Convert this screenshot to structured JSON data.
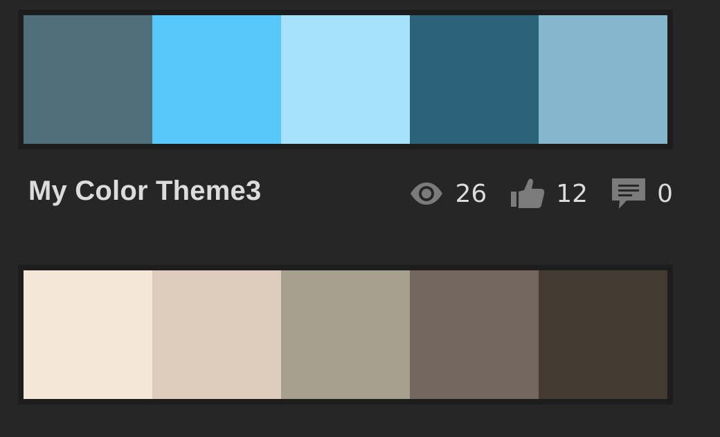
{
  "themes": [
    {
      "title": "My Color Theme3",
      "swatches": [
        "#4e6e79",
        "#57c7fa",
        "#a6e1fb",
        "#2a6379",
        "#86b6cb"
      ],
      "views": "26",
      "likes": "12",
      "comments": "0"
    },
    {
      "swatches": [
        "#f4e6d8",
        "#dcccbc",
        "#a69e8f",
        "#73675d",
        "#433a31"
      ]
    }
  ],
  "icons": {
    "views": "eye-icon",
    "likes": "thumbs-up-icon",
    "comments": "comment-icon"
  },
  "colors": {
    "background": "#262626",
    "text": "#dcdcdc",
    "icon": "#7b7b7b"
  }
}
